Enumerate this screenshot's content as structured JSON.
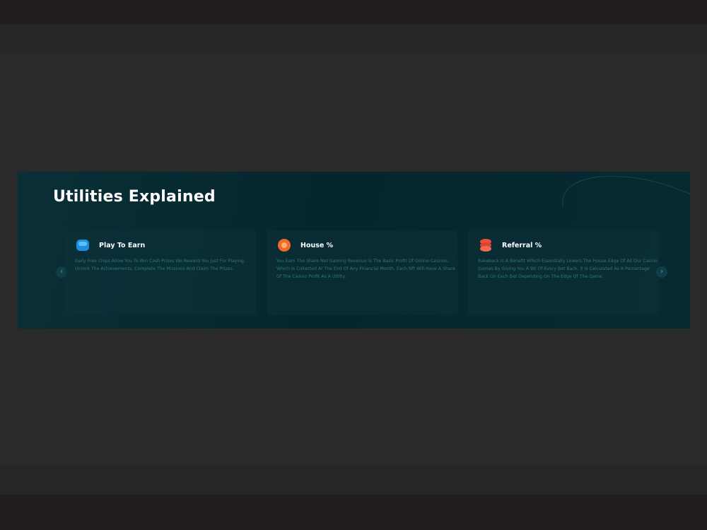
{
  "section": {
    "title": "Utilities Explained"
  },
  "cards": [
    {
      "title": "Play To Earn",
      "icon": "blue-chip-icon",
      "description": "Daily Free Chips Allow You To Win Cash Prizes We Reward You Just For Playing. Unlock The Achievements, Complete The Missions And Claim The Prizes."
    },
    {
      "title": "House %",
      "icon": "orange-chip-icon",
      "description": "You Earn The Share Net Gaming Revenue Is The Basic Profit Of Online Casinos, Which Is Collected At The End Of Any Financial Month. Each Nft Will Have A Share Of The Casino Profit As A Utility."
    },
    {
      "title": "Referral %",
      "icon": "stacked-coins-icon",
      "description": "Rakeback Is A Benefit Which Essentially Lowers The House Edge Of All Our Casino Games By Giving You A Bit Of Every Bet Back. It Is Calculated As A Percentage Back On Each Bet Depending On The Edge Of The Game."
    }
  ],
  "nav": {
    "prev_symbol": "‹",
    "next_symbol": "›"
  },
  "colors": {
    "panel_bg": "#072a31",
    "card_bg": "#0c323a",
    "desc_text": "#2c7a74",
    "title_text": "#ffffff"
  }
}
